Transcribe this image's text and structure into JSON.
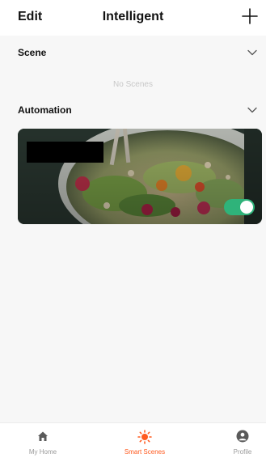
{
  "header": {
    "edit_label": "Edit",
    "title": "Intelligent",
    "add_icon": "plus-icon"
  },
  "scene": {
    "label": "Scene",
    "empty_text": "No Scenes",
    "chevron_icon": "chevron-down-icon"
  },
  "automation": {
    "label": "Automation",
    "chevron_icon": "chevron-down-icon",
    "cards": [
      {
        "image": "food-salad-photo",
        "name_redacted": true,
        "enabled": true
      }
    ]
  },
  "tabbar": {
    "tabs": [
      {
        "label": "My Home",
        "icon": "home-icon",
        "active": false
      },
      {
        "label": "Smart Scenes",
        "icon": "sun-icon",
        "active": true
      },
      {
        "label": "Profile",
        "icon": "profile-icon",
        "active": false
      }
    ]
  },
  "colors": {
    "accent": "#ff5a1f",
    "toggle_on": "#2fb37a",
    "background": "#f7f7f7"
  }
}
